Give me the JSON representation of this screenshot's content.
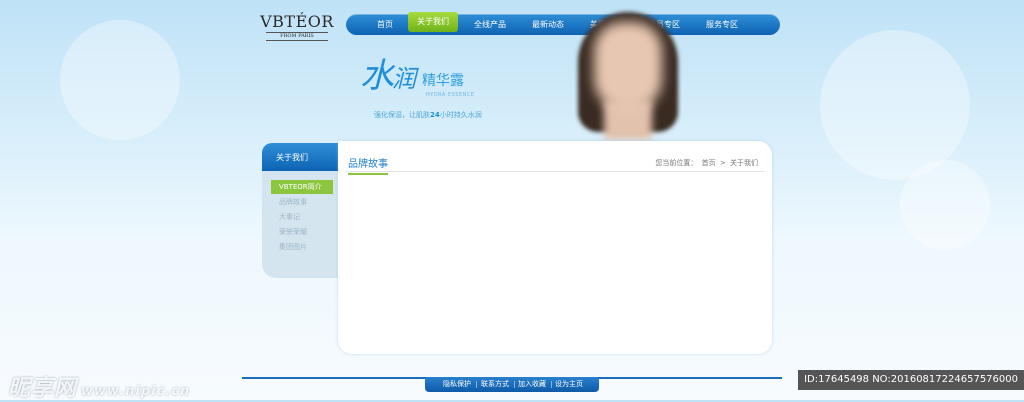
{
  "logo": {
    "main": "VBTÉOR",
    "sub": "FROM PARIS"
  },
  "nav": {
    "items": [
      "首页",
      "关于我们",
      "全线产品",
      "最新动态",
      "美丽分享",
      "会员专区",
      "服务专区"
    ],
    "active_index": 1
  },
  "promo": {
    "big": "水",
    "big2": "润",
    "title_small": "精华露",
    "english": "HYDRA ESSENCE",
    "tagline_a": "强化保湿，让肌肤",
    "tagline_hl": "24",
    "tagline_b": "小时持久水润"
  },
  "sidebar": {
    "title": "关于我们",
    "items": [
      "VBTEOR简介",
      "品牌故事",
      "大事记",
      "荣誉荣耀",
      "集团图片"
    ],
    "active_index": 0
  },
  "content": {
    "title": "品牌故事",
    "breadcrumb": {
      "prefix": "您当前位置：",
      "home": "首页",
      "sep": ">",
      "current": "关于我们"
    }
  },
  "footer": {
    "links": [
      "隐私保护",
      "联系方式",
      "加入收藏",
      "设为主页"
    ]
  },
  "watermark": {
    "left": "昵享网",
    "url": "www.nipic.cn",
    "right": "ID:17645498 NO:20160817224657576000"
  },
  "colors": {
    "nav_blue": "#0d63b3",
    "accent_green": "#8cc63e",
    "promo_blue": "#1e8fd8"
  }
}
